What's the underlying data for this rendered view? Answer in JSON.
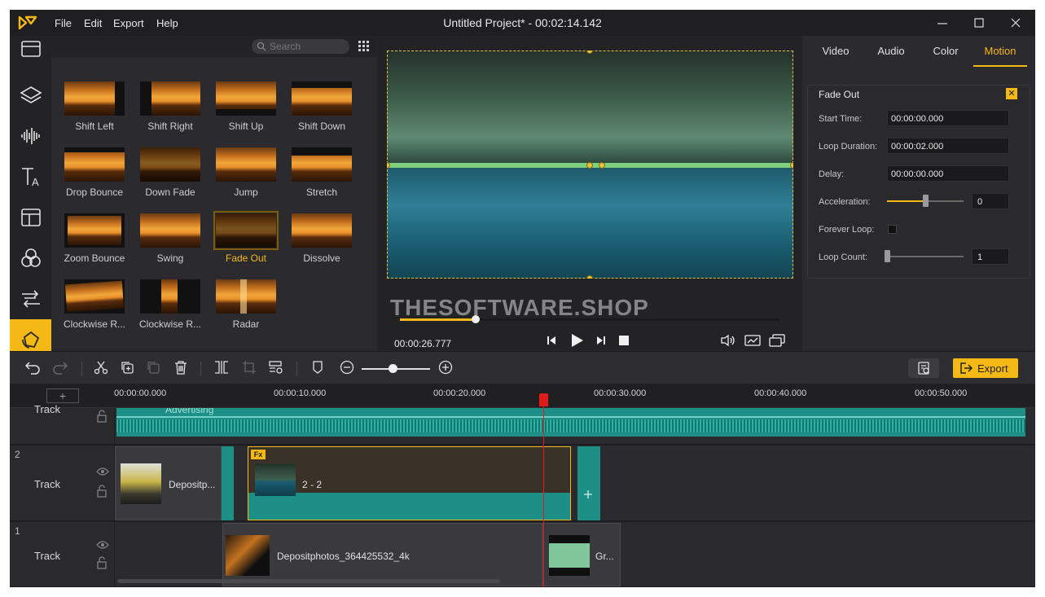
{
  "app": {
    "title": "Untitled Project* - 00:02:14.142",
    "accent": "#f5b915",
    "menu": [
      "File",
      "Edit",
      "Export",
      "Help"
    ]
  },
  "window_controls": [
    "minimize-icon",
    "maximize-icon",
    "close-icon"
  ],
  "sidebar": {
    "items": [
      {
        "icon": "media-icon",
        "active": false
      },
      {
        "icon": "layers-icon",
        "active": false
      },
      {
        "icon": "audio-wave-icon",
        "active": false
      },
      {
        "icon": "text-icon",
        "active": false
      },
      {
        "icon": "template-icon",
        "active": false
      },
      {
        "icon": "filters-icon",
        "active": false
      },
      {
        "icon": "transitions-icon",
        "active": false
      },
      {
        "icon": "motion-icon",
        "active": true
      }
    ]
  },
  "library": {
    "search_placeholder": "Search",
    "effects": [
      {
        "label": "Shift Left",
        "selected": false
      },
      {
        "label": "Shift Right",
        "selected": false
      },
      {
        "label": "Shift Up",
        "selected": false
      },
      {
        "label": "Shift Down",
        "selected": false
      },
      {
        "label": "Drop Bounce",
        "selected": false
      },
      {
        "label": "Down Fade",
        "selected": false
      },
      {
        "label": "Jump",
        "selected": false
      },
      {
        "label": "Stretch",
        "selected": false
      },
      {
        "label": "Zoom Bounce",
        "selected": false
      },
      {
        "label": "Swing",
        "selected": false
      },
      {
        "label": "Fade Out",
        "selected": true
      },
      {
        "label": "Dissolve",
        "selected": false
      },
      {
        "label": "Clockwise R...",
        "selected": false
      },
      {
        "label": "Clockwise R...",
        "selected": false
      },
      {
        "label": "Radar",
        "selected": false
      }
    ]
  },
  "preview": {
    "watermark": "THESOFTWARE.SHOP",
    "timecode": "00:00:26.777",
    "progress": 0.2
  },
  "properties": {
    "tabs": [
      "Video",
      "Audio",
      "Color",
      "Motion"
    ],
    "active_tab": "Motion",
    "panel_title": "Fade Out",
    "start_time_label": "Start Time:",
    "start_time": "00:00:00.000",
    "loop_duration_label": "Loop Duration:",
    "loop_duration": "00:00:02.000",
    "delay_label": "Delay:",
    "delay": "00:00:00.000",
    "acceleration_label": "Acceleration:",
    "acceleration": "0",
    "acceleration_level": 0.5,
    "forever_loop_label": "Forever Loop:",
    "forever_loop": false,
    "loop_count_label": "Loop Count:",
    "loop_count": "1",
    "loop_count_level": 0.0
  },
  "toolbar": {
    "export_label": "Export",
    "zoom_level": 0.45
  },
  "timeline": {
    "add_track": "+",
    "ruler": [
      "00:00:00.000",
      "00:00:10.000",
      "00:00:20.000",
      "00:00:30.000",
      "00:00:40.000",
      "00:00:50.000"
    ],
    "tracks": [
      {
        "label": "Track",
        "number": ""
      },
      {
        "label": "Track",
        "number": "2"
      },
      {
        "label": "Track",
        "number": "1"
      }
    ],
    "audio_clip_label": "Advertising",
    "clips": {
      "track2_a": "Depositp...",
      "track2_b": "2 - 2",
      "track2_fx": "Fx",
      "track1_a": "Depositphotos_364425532_4k",
      "track1_b": "Gr..."
    }
  }
}
